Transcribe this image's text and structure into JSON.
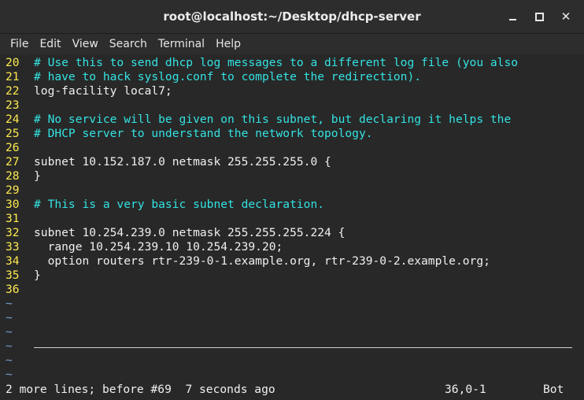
{
  "window": {
    "title": "root@localhost:~/Desktop/dhcp-server",
    "minimize_label": "",
    "maximize_label": "",
    "close_label": "✕"
  },
  "menu": {
    "items": [
      "File",
      "Edit",
      "View",
      "Search",
      "Terminal",
      "Help"
    ]
  },
  "editor": {
    "lines": [
      {
        "num": "20",
        "text": "# Use this to send dhcp log messages to a different log file (you also",
        "comment": true
      },
      {
        "num": "21",
        "text": "# have to hack syslog.conf to complete the redirection).",
        "comment": true
      },
      {
        "num": "22",
        "text": "log-facility local7;",
        "comment": false
      },
      {
        "num": "23",
        "text": "",
        "comment": false
      },
      {
        "num": "24",
        "text": "# No service will be given on this subnet, but declaring it helps the",
        "comment": true
      },
      {
        "num": "25",
        "text": "# DHCP server to understand the network topology.",
        "comment": true
      },
      {
        "num": "26",
        "text": "",
        "comment": false
      },
      {
        "num": "27",
        "text": "subnet 10.152.187.0 netmask 255.255.255.0 {",
        "comment": false
      },
      {
        "num": "28",
        "text": "}",
        "comment": false
      },
      {
        "num": "29",
        "text": "",
        "comment": false
      },
      {
        "num": "30",
        "text": "# This is a very basic subnet declaration.",
        "comment": true
      },
      {
        "num": "31",
        "text": "",
        "comment": false
      },
      {
        "num": "32",
        "text": "subnet 10.254.239.0 netmask 255.255.255.224 {",
        "comment": false
      },
      {
        "num": "33",
        "text": "  range 10.254.239.10 10.254.239.20;",
        "comment": false
      },
      {
        "num": "34",
        "text": "  option routers rtr-239-0-1.example.org, rtr-239-0-2.example.org;",
        "comment": false
      },
      {
        "num": "35",
        "text": "}",
        "comment": false
      },
      {
        "num": "36",
        "text": "",
        "comment": false
      }
    ],
    "empty_marker": "~",
    "empty_count": 6
  },
  "status": {
    "message": "2 more lines; before #69  7 seconds ago",
    "position": "36,0-1",
    "scroll": "Bot"
  },
  "colors": {
    "comment": "#34e2e2",
    "line_number": "#fce94f",
    "tilde": "#729fcf",
    "text": "#f0f0f0",
    "background": "#282828"
  }
}
